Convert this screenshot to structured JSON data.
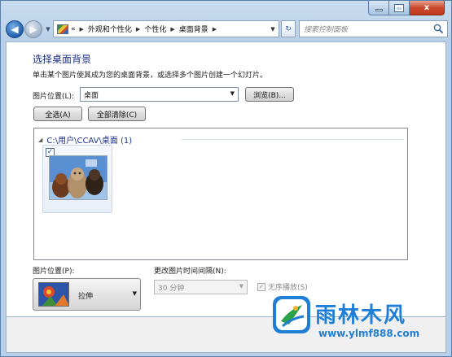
{
  "window": {
    "minimize_icon": "minimize-icon",
    "maximize_icon": "maximize-icon",
    "close_label": "x"
  },
  "nav": {
    "back_icon": "back-arrow-icon",
    "forward_icon": "forward-arrow-icon",
    "breadcrumb": [
      "外观和个性化",
      "个性化",
      "桌面背景"
    ],
    "breadcrumb_prefix": "«",
    "search_placeholder": "搜索控制面板"
  },
  "page": {
    "title": "选择桌面背景",
    "subtitle": "单击某个图片使其成为您的桌面背景，或选择多个图片创建一个幻灯片。",
    "location_label": "图片位置(L):",
    "location_value": "桌面",
    "browse_label": "浏览(B)...",
    "select_all_label": "全选(A)",
    "clear_all_label": "全部清除(C)"
  },
  "gallery": {
    "group_title": "C:\\用户\\CCAV\\桌面 (1)",
    "items": [
      {
        "checked": true,
        "check_mark": "✓"
      }
    ]
  },
  "position": {
    "label": "图片位置(P):",
    "value": "拉伸"
  },
  "interval": {
    "label": "更改图片时间间隔(N):",
    "value": "30 分钟"
  },
  "shuffle": {
    "label": "无序播放(S)",
    "checked": true,
    "check_mark": "✓"
  },
  "watermark": {
    "brand": "雨林木风",
    "url": "www.ylmf888.com"
  },
  "colors": {
    "title_blue": "#1e3287",
    "watermark_blue": "#1f7fd6",
    "close_red": "#c0391e"
  }
}
